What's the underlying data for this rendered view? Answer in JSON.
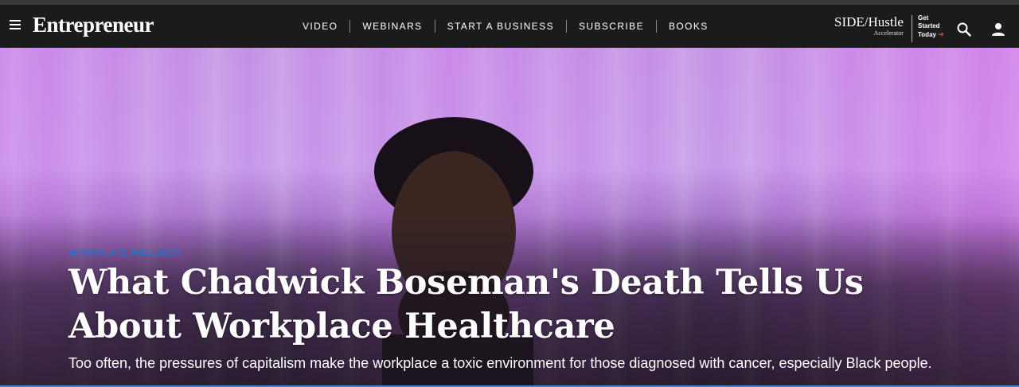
{
  "header": {
    "logo": "Entrepreneur",
    "nav": [
      {
        "label": "VIDEO"
      },
      {
        "label": "WEBINARS"
      },
      {
        "label": "START A BUSINESS"
      },
      {
        "label": "SUBSCRIBE"
      },
      {
        "label": "BOOKS"
      }
    ],
    "promo": {
      "title": "SIDE/Hustle",
      "subtitle": "Accelerator",
      "cta_line1": "Get",
      "cta_line2": "Started",
      "cta_line3": "Today",
      "cta_arrow": "➔"
    },
    "icons": {
      "menu": "menu-icon",
      "search": "search-icon",
      "user": "user-icon"
    }
  },
  "article": {
    "category": "WORKPLACE WELLNESS",
    "headline": "What Chadwick Boseman's Death Tells Us About Workplace Healthcare",
    "dek": "Too often, the pressures of capitalism make the workplace a toxic environment for those diagnosed with cancer, especially Black people."
  },
  "colors": {
    "nav_bg": "#1b1b1b",
    "category": "#2a6fc9",
    "arrow_red": "#e03030"
  }
}
